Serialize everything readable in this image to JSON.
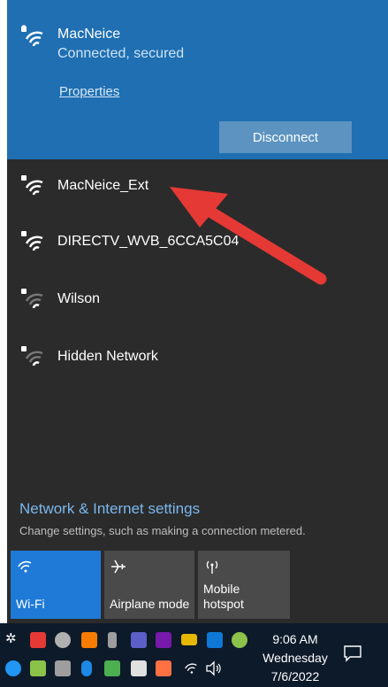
{
  "connected": {
    "name": "MacNeice",
    "status": "Connected, secured",
    "properties_label": "Properties",
    "disconnect_label": "Disconnect"
  },
  "networks": [
    {
      "name": "MacNeice_Ext"
    },
    {
      "name": "DIRECTV_WVB_6CCA5C04"
    },
    {
      "name": "Wilson"
    },
    {
      "name": "Hidden Network"
    }
  ],
  "settings": {
    "title": "Network & Internet settings",
    "subtitle": "Change settings, such as making a connection metered."
  },
  "tiles": [
    {
      "label": "Wi-Fi",
      "icon": "wifi-icon",
      "active": true
    },
    {
      "label": "Airplane mode",
      "icon": "airplane-icon",
      "active": false
    },
    {
      "label": "Mobile hotspot",
      "icon": "hotspot-icon",
      "active": false
    }
  ],
  "taskbar": {
    "time": "9:06 AM",
    "day": "Wednesday",
    "date": "7/6/2022"
  },
  "colors": {
    "connected_bg": "#1f6fb2",
    "flyout_bg": "#2b2b2b",
    "accent": "#1e7ad6",
    "arrow": "#e53935",
    "taskbar_bg": "#0d1a2a"
  }
}
